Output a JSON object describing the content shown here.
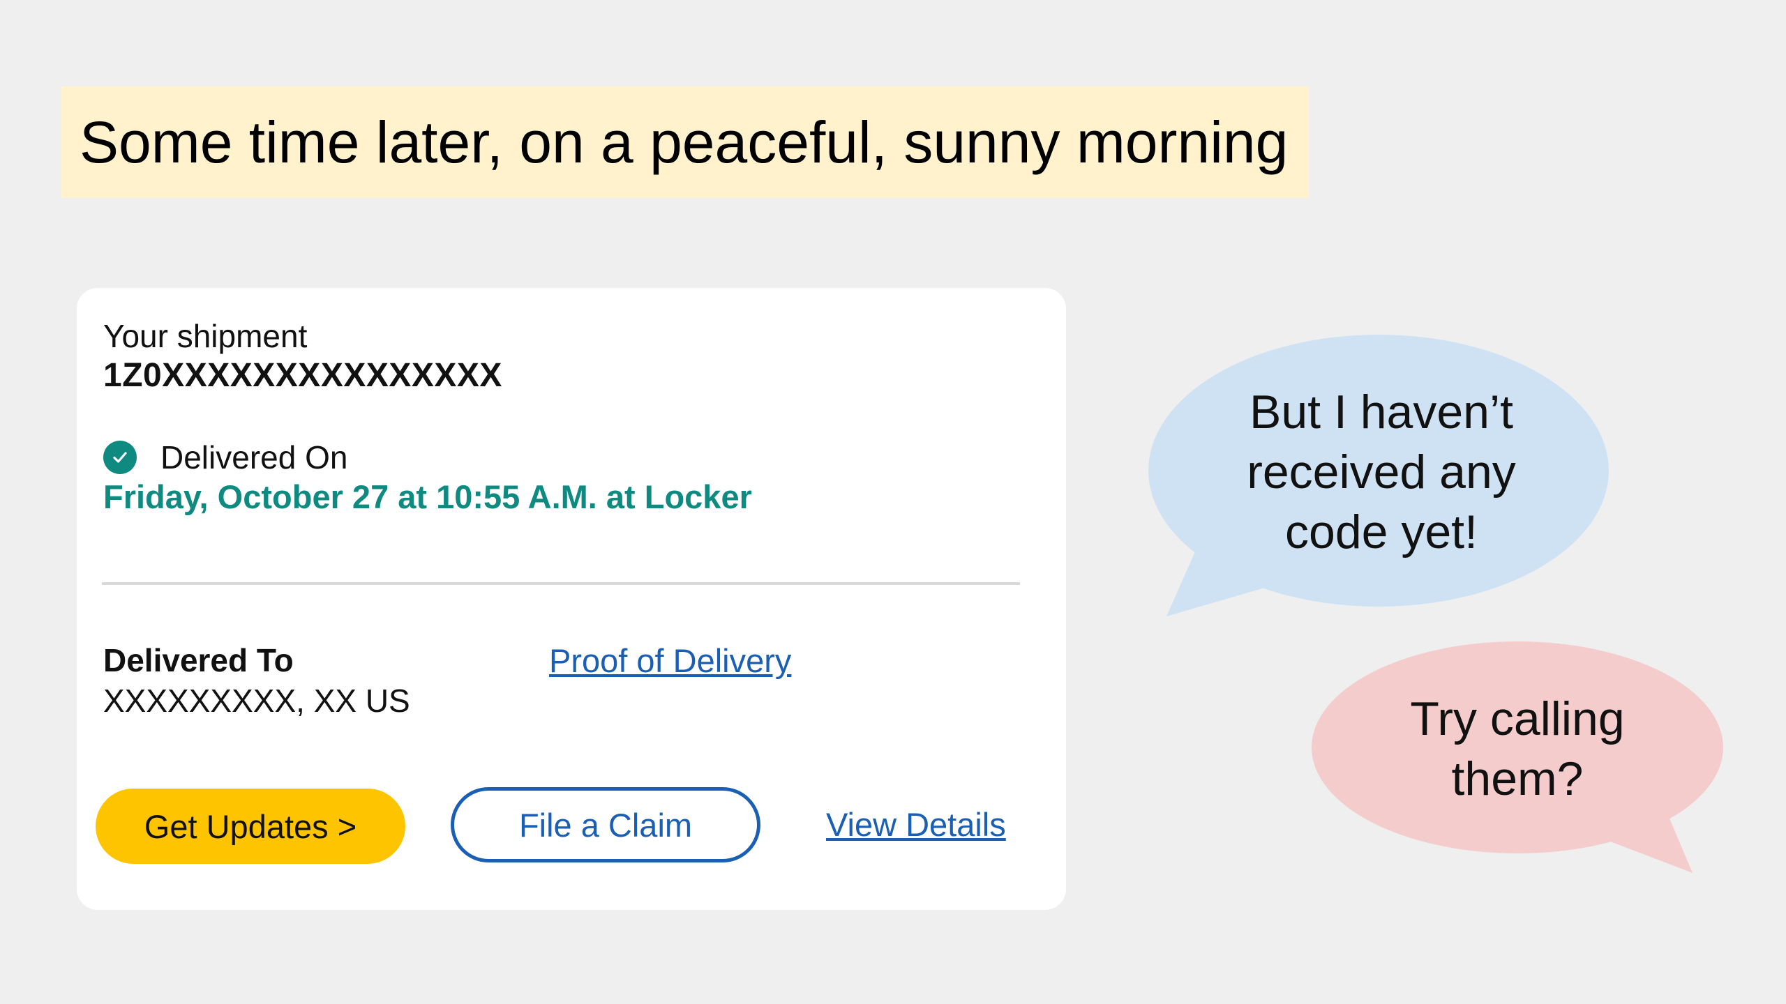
{
  "caption": {
    "text": "Some time later, on a peaceful, sunny morning"
  },
  "shipment": {
    "label": "Your shipment",
    "tracking_number": "1Z0XXXXXXXXXXXXXXX",
    "status_label": "Delivered On",
    "status_icon": "check-circle-icon",
    "delivery_datetime": "Friday, October 27 at 10:55 A.M. at Locker",
    "delivered_to_label": "Delivered To",
    "delivered_to_address": "XXXXXXXXX, XX US",
    "proof_link": "Proof of Delivery",
    "get_updates_button": "Get Updates >",
    "file_claim_button": "File a Claim",
    "view_details_link": "View Details"
  },
  "colors": {
    "background": "#efefef",
    "caption_bg": "#fff2cc",
    "status_teal": "#0e8a80",
    "link_blue": "#1a5fb4",
    "button_yellow": "#ffc400",
    "bubble_blue": "#cfe2f3",
    "bubble_pink": "#f4cccc"
  },
  "bubbles": {
    "blue": {
      "lines": [
        "But I haven’t",
        "received any",
        "code yet!"
      ]
    },
    "pink": {
      "lines": [
        "Try calling",
        "them?"
      ]
    }
  }
}
